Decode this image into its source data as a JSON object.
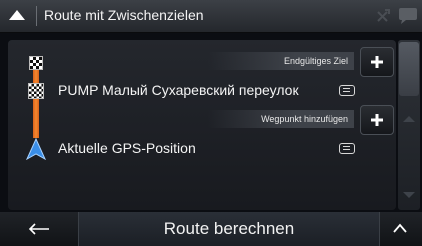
{
  "header": {
    "title": "Route mit Zwischenzielen",
    "left_icon": "back-triangle-icon",
    "tools_icon": "tools-icon",
    "message_icon": "message-bubble-icon"
  },
  "route": {
    "final_destination_label": "Endgültiges Ziel",
    "add_waypoint_label": "Wegpunkt hinzufügen",
    "destination": "PUMP Малый Сухаревский переулок",
    "start": "Aktuelle GPS-Position"
  },
  "footer": {
    "calculate_label": "Route berechnen"
  },
  "colors": {
    "route_line": "#f5882e",
    "gps_arrow": "#3a8ee8"
  }
}
